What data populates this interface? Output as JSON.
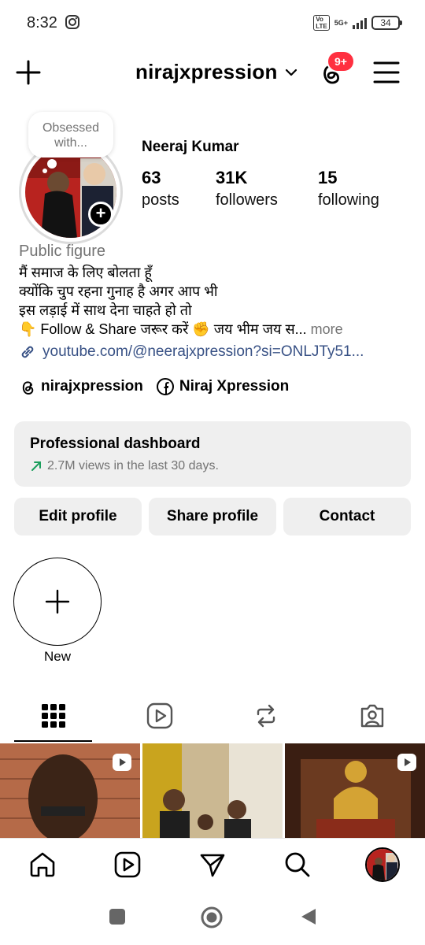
{
  "status": {
    "time": "8:32",
    "network": "5G+",
    "volte": "Vo LTE",
    "battery": "34"
  },
  "header": {
    "username": "nirajxpression",
    "notification_badge": "9+"
  },
  "profile": {
    "note": "Obsessed with...",
    "full_name": "Neeraj Kumar",
    "stats": [
      {
        "value": "63",
        "label": "posts"
      },
      {
        "value": "31K",
        "label": "followers"
      },
      {
        "value": "15",
        "label": "following"
      }
    ],
    "category": "Public figure",
    "bio": {
      "line1": "मैं समाज के लिए बोलता हूँ",
      "line2": "क्योंकि चुप रहना गुनाह है अगर आप भी",
      "line3": "इस लड़ाई में साथ देना चाहते हो तो",
      "line4": "👇 Follow & Share जरूर करें ✊ जय भीम  जय स...",
      "more": " more"
    },
    "link": "youtube.com/@neerajxpression?si=ONLJTy51...",
    "threads_handle": "nirajxpression",
    "facebook_name": "Niraj Xpression"
  },
  "dashboard": {
    "title": "Professional dashboard",
    "subtitle": "2.7M views in the last 30 days."
  },
  "buttons": {
    "edit": "Edit profile",
    "share": "Share profile",
    "contact": "Contact"
  },
  "highlights": {
    "new_label": "New"
  },
  "colors": {
    "accent_link": "#385185",
    "badge": "#ff3040",
    "trend": "#1a9e5c",
    "button_bg": "#efefef"
  }
}
